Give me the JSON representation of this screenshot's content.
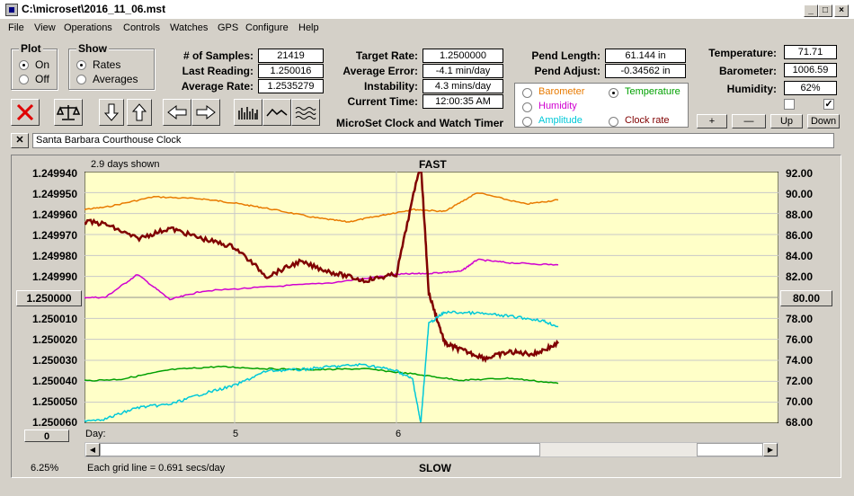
{
  "window": {
    "title": "C:\\microset\\2016_11_06.mst"
  },
  "menu": [
    "File",
    "View",
    "Operations",
    "Controls",
    "Watches",
    "GPS",
    "Configure",
    "Help"
  ],
  "plot_group": {
    "title": "Plot",
    "on": "On",
    "off": "Off",
    "selected": "On"
  },
  "show_group": {
    "title": "Show",
    "rates": "Rates",
    "averages": "Averages",
    "selected": "Rates"
  },
  "stats": {
    "samples_label": "# of Samples:",
    "samples": "21419",
    "last_label": "Last Reading:",
    "last": "1.250016",
    "avg_rate_label": "Average Rate:",
    "avg_rate": "1.2535279",
    "target_label": "Target Rate:",
    "target": "1.2500000",
    "avg_err_label": "Average Error:",
    "avg_err": "-4.1 min/day",
    "instab_label": "Instability:",
    "instab": "4.3 mins/day",
    "time_label": "Current Time:",
    "time": "12:00:35 AM",
    "pend_len_label": "Pend Length:",
    "pend_len": "61.144 in",
    "pend_adj_label": "Pend Adjust:",
    "pend_adj": "-0.34562 in",
    "temp_label": "Temperature:",
    "temp": "71.71",
    "baro_label": "Barometer:",
    "baro": "1006.59",
    "hum_label": "Humidity:",
    "hum": "62%"
  },
  "subtitle": "MicroSet Clock and Watch Timer",
  "sensor_options": [
    {
      "label": "Barometer",
      "color": "#e87a00",
      "selected": false
    },
    {
      "label": "Temperature",
      "color": "#00a000",
      "selected": true
    },
    {
      "label": "Humidity",
      "color": "#d000d0",
      "selected": false
    },
    {
      "label": "Clock rate",
      "color": "#800000",
      "selected": false
    },
    {
      "label": "Amplitude",
      "color": "#00c8d8",
      "selected": false
    }
  ],
  "scale_buttons": {
    "plus": "+",
    "minus": "—",
    "up": "Up",
    "down": "Down"
  },
  "checkboxes": [
    false,
    true
  ],
  "clock_name": "Santa Barbara Courthouse Clock",
  "graph": {
    "days_shown": "2.9 days shown",
    "top_label": "FAST",
    "bottom_label": "SLOW",
    "center_left_button": "1.250000",
    "center_right_button": "80.00",
    "zero_button": "0",
    "percent": "6.25%",
    "grid_note": "Each grid line = 0.691 secs/day",
    "day_label": "Day:",
    "day_ticks": [
      "5",
      "6"
    ],
    "left_axis": [
      "1.249940",
      "1.249950",
      "1.249960",
      "1.249970",
      "1.249980",
      "1.249990",
      "1.250010",
      "1.250020",
      "1.250030",
      "1.250040",
      "1.250050",
      "1.250060"
    ],
    "right_axis": [
      "92.00",
      "90.00",
      "88.00",
      "86.00",
      "84.00",
      "82.00",
      "78.00",
      "76.00",
      "74.00",
      "72.00",
      "70.00",
      "68.00"
    ]
  },
  "chart_data": {
    "type": "line",
    "x_unit": "day",
    "series": [
      {
        "name": "Barometer",
        "color": "#e87a00",
        "x": [
          4.0,
          4.2,
          4.5,
          4.8,
          5.0,
          5.2,
          5.5,
          5.7,
          5.9,
          6.1,
          6.3,
          6.5,
          6.8,
          7.0
        ],
        "y": [
          88.3,
          88.6,
          89.6,
          89.4,
          89.0,
          88.5,
          87.6,
          87.2,
          87.8,
          88.4,
          88.2,
          90.0,
          88.9,
          89.3
        ]
      },
      {
        "name": "Humidity",
        "color": "#d000d0",
        "x": [
          4.0,
          4.2,
          4.4,
          4.6,
          4.8,
          5.2,
          5.6,
          6.0,
          6.2,
          6.4,
          6.5,
          6.7,
          7.0
        ],
        "y": [
          80.0,
          80.0,
          82.2,
          79.8,
          80.6,
          81.0,
          81.4,
          82.2,
          82.3,
          82.5,
          83.6,
          83.3,
          83.1
        ]
      },
      {
        "name": "Temperature",
        "color": "#00a000",
        "x": [
          4.0,
          4.3,
          4.6,
          4.9,
          5.2,
          5.5,
          5.8,
          6.1,
          6.4,
          6.7,
          7.0
        ],
        "y": [
          72.0,
          72.2,
          73.1,
          73.4,
          73.2,
          73.1,
          73.2,
          72.7,
          72.1,
          72.3,
          71.8
        ]
      },
      {
        "name": "Clock rate",
        "color": "#800000",
        "x": [
          4.0,
          4.2,
          4.4,
          4.6,
          4.8,
          5.0,
          5.2,
          5.4,
          5.6,
          5.8,
          6.0,
          6.15,
          6.2,
          6.3,
          6.4,
          6.55,
          6.7,
          6.85,
          7.0
        ],
        "y": [
          1.249963,
          1.249965,
          1.249972,
          1.249967,
          1.249972,
          1.249976,
          1.24999,
          1.249983,
          1.249988,
          1.249992,
          1.249989,
          1.249935,
          1.249998,
          1.250022,
          1.250025,
          1.250029,
          1.250026,
          1.250027,
          1.250022
        ]
      },
      {
        "name": "Amplitude",
        "color": "#00c8d8",
        "x": [
          4.0,
          4.2,
          4.4,
          4.6,
          4.8,
          5.0,
          5.2,
          5.4,
          5.6,
          5.8,
          6.0,
          6.1,
          6.15,
          6.2,
          6.3,
          6.5,
          6.7,
          6.9,
          7.0
        ],
        "y": [
          68.2,
          68.4,
          69.5,
          69.8,
          70.8,
          71.6,
          73.0,
          73.1,
          73.4,
          73.6,
          73.0,
          72.2,
          68.0,
          77.5,
          78.6,
          78.5,
          78.2,
          77.8,
          77.2
        ]
      }
    ]
  }
}
